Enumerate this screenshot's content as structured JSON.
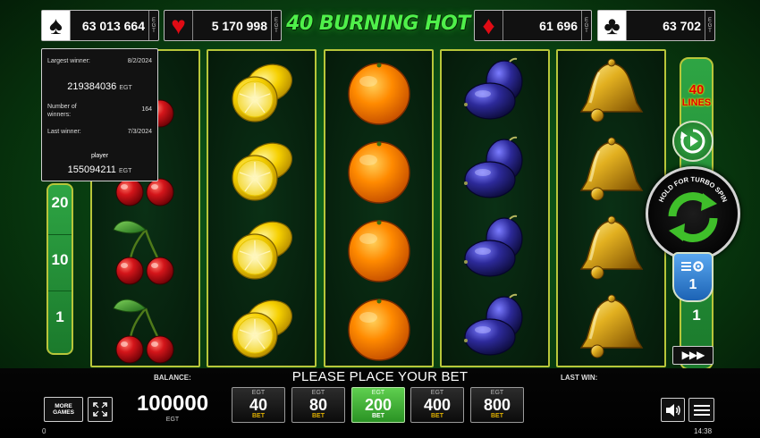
{
  "jackpots": [
    {
      "suit": "spade",
      "symbol": "♠",
      "amount": "63 013 664",
      "badge": "EGT"
    },
    {
      "suit": "heart",
      "symbol": "♥",
      "amount": "5 170 998",
      "badge": "EGT"
    },
    {
      "suit": "diamond",
      "symbol": "♦",
      "amount": "61 696",
      "badge": "EGT"
    },
    {
      "suit": "club",
      "symbol": "♣",
      "amount": "63 702",
      "badge": "EGT"
    }
  ],
  "logo": "40 BURNING HOT",
  "tooltip": {
    "largest_label": "Largest winner:",
    "largest_date": "8/2/2024",
    "largest_id": "219384036",
    "currency": "EGT",
    "num_winners_label": "Number of winners:",
    "num_winners": "164",
    "last_label": "Last winner:",
    "last_date": "7/3/2024",
    "player_label": "player",
    "player_id": "155094211"
  },
  "left_lines": [
    "20",
    "10",
    "1"
  ],
  "reels": [
    [
      "cherry",
      "cherry",
      "cherry",
      "cherry"
    ],
    [
      "lemon",
      "lemon",
      "lemon",
      "lemon"
    ],
    [
      "orange",
      "orange",
      "orange",
      "orange"
    ],
    [
      "plum",
      "plum",
      "plum",
      "plum"
    ],
    [
      "bell",
      "bell",
      "bell",
      "bell"
    ]
  ],
  "right_panel": {
    "lines_number": "40",
    "lines_word": "LINES",
    "spin_hint": "HOLD FOR TURBO SPIN",
    "speed_value": "1",
    "bottom_number": "1",
    "turbo_icon": "fast-forward-icon"
  },
  "bottom": {
    "place_bet": "PLEASE PLACE YOUR BET",
    "balance_label": "BALANCE:",
    "balance": "100000",
    "balance_currency": "EGT",
    "last_win_label": "LAST WIN:",
    "more_games": "MORE GAMES",
    "credit": "0",
    "clock": "14:38"
  },
  "bets": [
    {
      "badge": "EGT",
      "value": "40",
      "label": "BET",
      "active": false
    },
    {
      "badge": "EGT",
      "value": "80",
      "label": "BET",
      "active": false
    },
    {
      "badge": "EGT",
      "value": "200",
      "label": "BET",
      "active": true
    },
    {
      "badge": "EGT",
      "value": "400",
      "label": "BET",
      "active": false
    },
    {
      "badge": "EGT",
      "value": "800",
      "label": "BET",
      "active": false
    }
  ],
  "colors": {
    "accent_green": "#2ea544",
    "reel_border": "#b8c63a",
    "active_bet": "#4fbf40",
    "lines_red": "#e40000"
  }
}
